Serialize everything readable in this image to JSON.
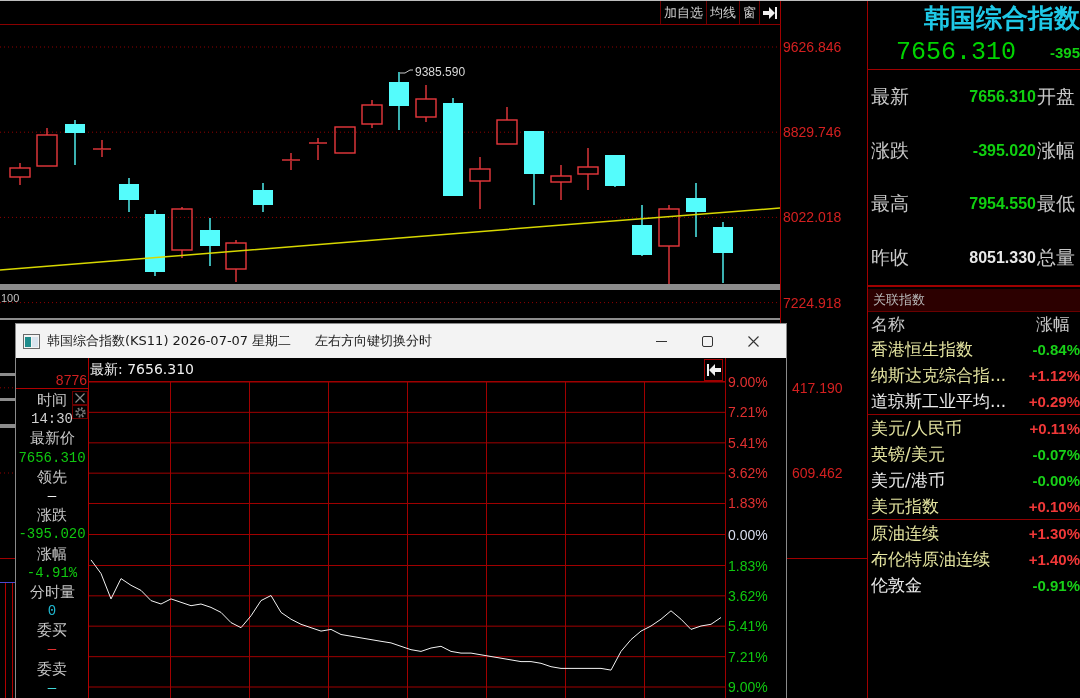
{
  "main_chart": {
    "toolbar": [
      "加自选",
      "均线",
      "窗"
    ],
    "peak_label": "9385.590",
    "volume_label": "100",
    "price_labels": [
      "9626.846",
      "8829.746",
      "8022.018",
      "7224.918",
      "417.190",
      "609.462"
    ]
  },
  "quote_panel": {
    "title": "韩国综合指数",
    "price": "7656.310",
    "change": "-395",
    "rows": [
      {
        "label": "最新",
        "value": "7656.310",
        "color": "#10d010",
        "side_label": "开盘"
      },
      {
        "label": "涨跌",
        "value": "-395.020",
        "color": "#10d010",
        "side_label": "涨幅"
      },
      {
        "label": "最高",
        "value": "7954.550",
        "color": "#10d010",
        "side_label": "最低"
      },
      {
        "label": "昨收",
        "value": "8051.330",
        "color": "#e8e8e8",
        "side_label": "总量"
      }
    ]
  },
  "related": {
    "title": "关联指数",
    "columns": [
      "名称",
      "涨幅"
    ],
    "groups": [
      [
        {
          "name": "香港恒生指数",
          "highlighted": true,
          "change": "-0.84%",
          "color": "#18d018"
        },
        {
          "name": "纳斯达克综合指...",
          "highlighted": true,
          "change": "+1.12%",
          "color": "#f03838"
        },
        {
          "name": "道琼斯工业平均...",
          "highlighted": false,
          "change": "+0.29%",
          "color": "#f03838"
        }
      ],
      [
        {
          "name": "美元/人民币",
          "highlighted": true,
          "change": "+0.11%",
          "color": "#f03838"
        },
        {
          "name": "英镑/美元",
          "highlighted": true,
          "change": "-0.07%",
          "color": "#18d018"
        },
        {
          "name": "美元/港币",
          "highlighted": false,
          "change": "-0.00%",
          "color": "#18d018"
        },
        {
          "name": "美元指数",
          "highlighted": true,
          "change": "+0.10%",
          "color": "#f03838"
        }
      ],
      [
        {
          "name": "原油连续",
          "highlighted": true,
          "change": "+1.30%",
          "color": "#f03838"
        },
        {
          "name": "布伦特原油连续",
          "highlighted": true,
          "change": "+1.40%",
          "color": "#f03838"
        },
        {
          "name": "伦敦金",
          "highlighted": false,
          "change": "-0.91%",
          "color": "#18d018"
        }
      ]
    ]
  },
  "popup": {
    "title": "韩国综合指数(KS11) 2026-07-07 星期二",
    "hint": "左右方向键切换分时",
    "scale_label": "8776",
    "info": [
      {
        "label": "时间",
        "value": "14:30",
        "color": "#d0d0d0"
      },
      {
        "label": "最新价",
        "value": "7656.310",
        "color": "#10c810"
      },
      {
        "label": "领先",
        "value": "—",
        "color": "#f0f0f0"
      },
      {
        "label": "涨跌",
        "value": "-395.020",
        "color": "#10c810"
      },
      {
        "label": "涨幅",
        "value": "-4.91%",
        "color": "#10c810"
      },
      {
        "label": "分时量",
        "value": "0",
        "color": "#20b8d0"
      },
      {
        "label": "委买",
        "value": "—",
        "color": "#e03030"
      },
      {
        "label": "委卖",
        "value": "—",
        "color": "#40d8d8"
      }
    ],
    "latest": "最新: 7656.310",
    "chart_data": {
      "type": "line",
      "grid": true,
      "ylim": [
        -9,
        9
      ],
      "yticks": [
        {
          "value": 9,
          "label": "9.00%"
        },
        {
          "value": 7.21,
          "label": "7.21%"
        },
        {
          "value": 5.41,
          "label": "5.41%"
        },
        {
          "value": 3.62,
          "label": "3.62%"
        },
        {
          "value": 1.83,
          "label": "1.83%"
        },
        {
          "value": 0,
          "label": "0.00%"
        },
        {
          "value": -1.83,
          "label": "1.83%"
        },
        {
          "value": -3.62,
          "label": "3.62%"
        },
        {
          "value": -5.41,
          "label": "5.41%"
        },
        {
          "value": -7.21,
          "label": "7.21%"
        },
        {
          "value": -9,
          "label": "9.00%"
        }
      ],
      "values": [
        -1.5,
        -2.3,
        -3.8,
        -2.6,
        -3.0,
        -3.3,
        -3.9,
        -4.1,
        -3.8,
        -4.0,
        -4.2,
        -4.1,
        -4.3,
        -4.6,
        -5.2,
        -5.5,
        -4.8,
        -3.9,
        -3.6,
        -4.6,
        -5.0,
        -5.3,
        -5.5,
        -5.7,
        -5.6,
        -5.9,
        -6.0,
        -6.1,
        -6.2,
        -6.3,
        -6.4,
        -6.6,
        -6.8,
        -6.9,
        -6.7,
        -6.6,
        -6.9,
        -7.0,
        -7.0,
        -7.1,
        -7.2,
        -7.3,
        -7.4,
        -7.5,
        -7.5,
        -7.6,
        -7.8,
        -7.9,
        -7.9,
        -7.9,
        -7.9,
        -7.9,
        -8.0,
        -6.9,
        -6.2,
        -5.7,
        -5.4,
        -5.0,
        -4.5,
        -5.0,
        -5.6,
        -5.4,
        -5.3,
        -4.9
      ]
    }
  }
}
